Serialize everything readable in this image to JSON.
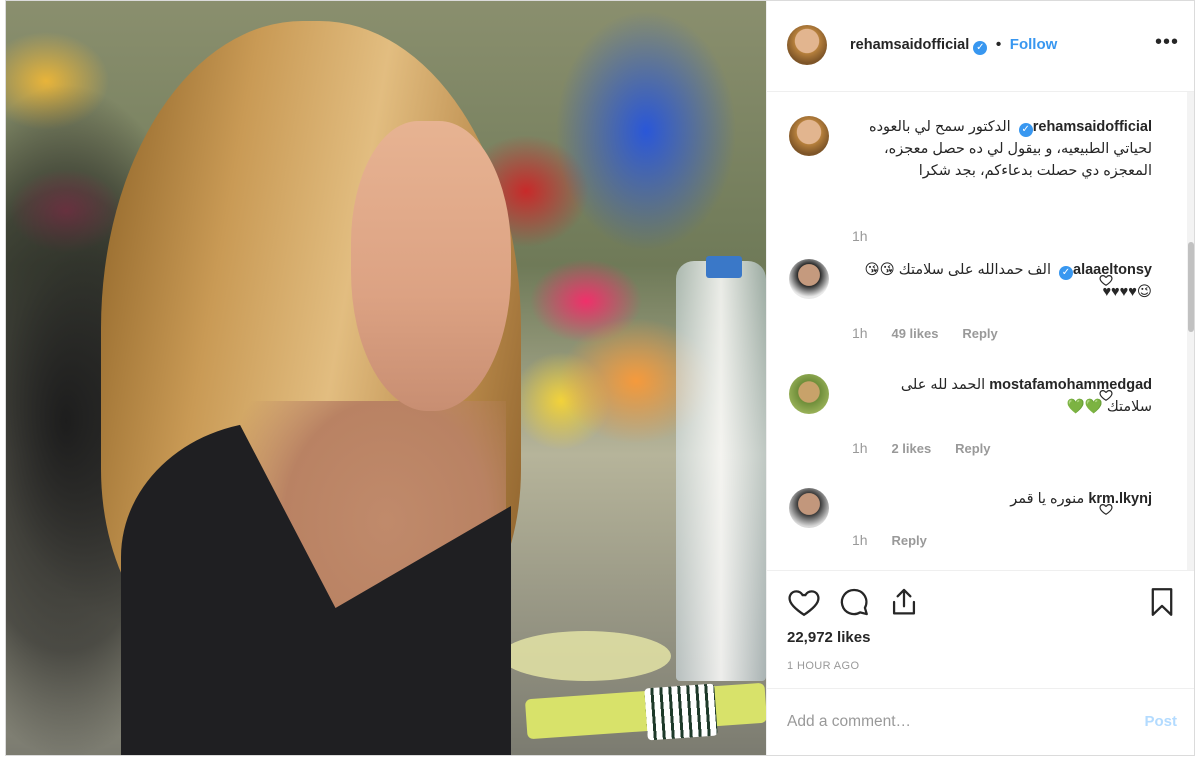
{
  "post": {
    "author": "rehamsaidofficial",
    "follow_sep": "•",
    "follow_label": "Follow",
    "more_label": "•••",
    "caption": "الدكتور سمح لي بالعوده لحياتي الطبيعيه، و بيقول لي ده حصل معجزه، المعجزه دي حصلت بدعاءكم، بجد شكرا",
    "caption_time": "1h",
    "likes": "22,972 likes",
    "timestamp": "1 HOUR AGO",
    "verified_glyph": "✓"
  },
  "comments": [
    {
      "user": "alaaeltonsy",
      "verified": true,
      "text": "الف حمدالله على سلامتك 😘😘😉♥♥♥♥",
      "time": "1h",
      "likes": "49 likes",
      "reply": "Reply"
    },
    {
      "user": "mostafamohammedgad",
      "verified": false,
      "text": "الحمد لله على سلامتك 💚💚",
      "time": "1h",
      "likes": "2 likes",
      "reply": "Reply"
    },
    {
      "user": "krm.lkynj",
      "verified": false,
      "text": "منوره يا قمر",
      "time": "1h",
      "likes": "",
      "reply": "Reply"
    }
  ],
  "composer": {
    "placeholder": "Add a comment…",
    "post_label": "Post"
  },
  "colors": {
    "accent": "#3897f0",
    "post_disabled": "#b3dbff",
    "muted": "#999999",
    "text": "#262626"
  },
  "icons": [
    "heart-icon",
    "comment-icon",
    "share-icon",
    "bookmark-icon",
    "verified-badge-icon",
    "more-options-icon",
    "like-comment-icon"
  ]
}
